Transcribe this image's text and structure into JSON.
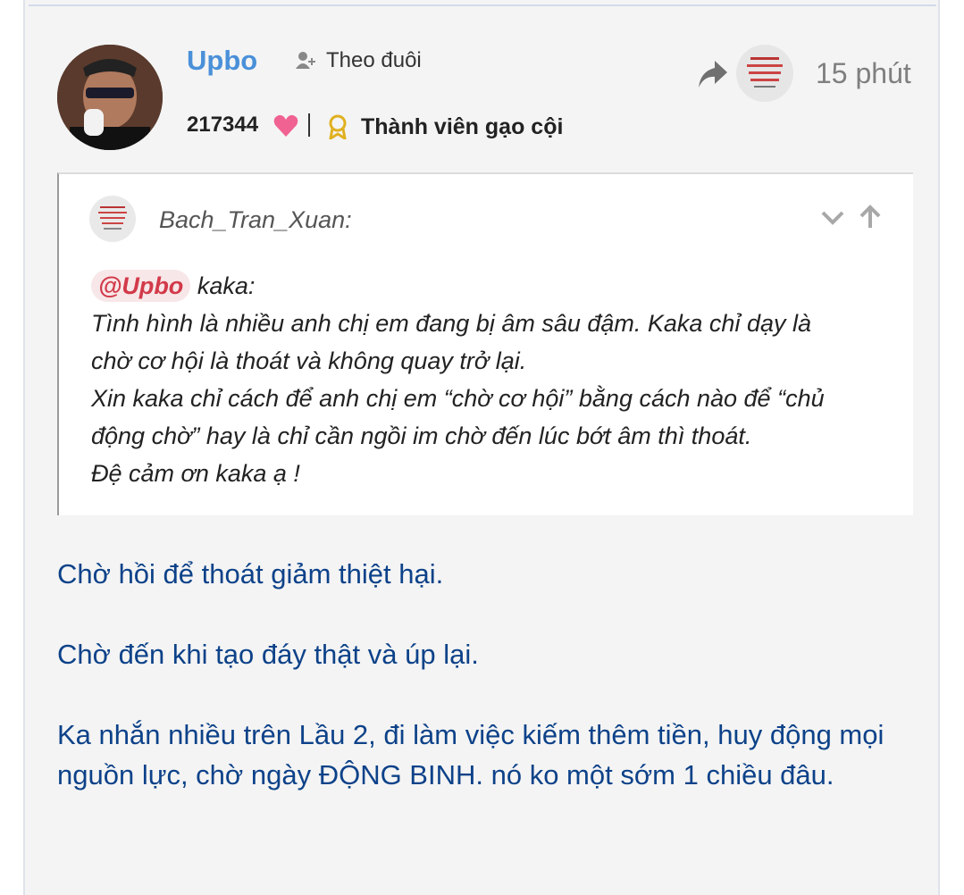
{
  "post": {
    "author": "Upbo",
    "follow_label": "Theo đuôi",
    "time": "15 phút",
    "likes": "217344",
    "rank": "Thành viên gạo cội",
    "icons": [
      "share-icon",
      "heart-icon",
      "badge-icon",
      "follow-icon"
    ],
    "colors": {
      "username": "#4a90d9",
      "reply_text": "#0d4289",
      "heart": "#f06292",
      "mention": "#d23a4a"
    }
  },
  "quote": {
    "author": "Bach_Tran_Xuan:",
    "mention": "@Upbo",
    "lines": [
      "kaka:",
      "Tình hình là nhiều anh chị em đang bị âm sâu đậm. Kaka chỉ dạy là",
      "chờ cơ hội là thoát và không quay trở lại.",
      "Xin kaka chỉ cách để anh chị em “chờ cơ hội” bằng cách nào để “chủ",
      "động chờ” hay là chỉ cần ngồi im chờ đến lúc bớt âm thì thoát.",
      "Đệ cảm ơn kaka ạ !"
    ]
  },
  "reply": {
    "paragraphs": [
      "Chờ hồi để thoát giảm thiệt hại.",
      "Chờ đến khi tạo đáy thật và úp lại.",
      "Ka nhắn nhiều trên Lầu 2, đi làm việc kiếm thêm tiền, huy động mọi nguồn lực, chờ ngày ĐỘNG BINH. nó ko một sớm 1 chiều đâu."
    ]
  }
}
